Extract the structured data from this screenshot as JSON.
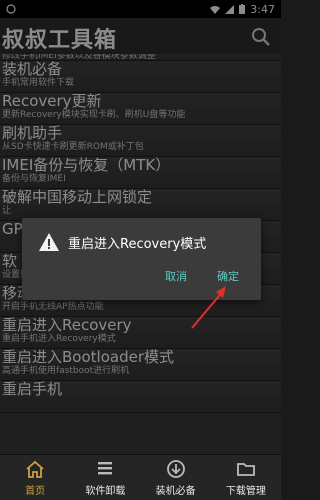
{
  "status": {
    "time": "3:47"
  },
  "appbar": {
    "title": "叔叔工具箱",
    "search_icon": "search-icon"
  },
  "list": {
    "partial_top": "修改手机IMEI参数以及各模块参数调整",
    "items": [
      {
        "title": "装机必备",
        "subtitle": "手机常用软件下载"
      },
      {
        "title": "Recovery更新",
        "subtitle": "更新Recovery模块实现卡刷、刷机U盘等功能"
      },
      {
        "title": "刷机助手",
        "subtitle": "从SD卡快速卡刷更新ROM或补丁包"
      },
      {
        "title": "IMEI备份与恢复（MTK）",
        "subtitle": "备份与恢复IMEI"
      },
      {
        "title": "破解中国移动上网锁定",
        "subtitle": "让"
      },
      {
        "title": "GP",
        "subtitle": ""
      },
      {
        "title": "软",
        "subtitle": "设置软件程序默认安装位置"
      },
      {
        "title": "移动热点AP",
        "subtitle": "开启手机无线AP热点功能"
      },
      {
        "title": "重启进入Recovery",
        "subtitle": "重启手机进入Recovery模式"
      },
      {
        "title": "重启进入Bootloader模式",
        "subtitle": "高通手机使用fastboot进行刷机"
      },
      {
        "title": "重启手机",
        "subtitle": ""
      }
    ]
  },
  "dialog": {
    "title": "重启进入Recovery模式",
    "cancel": "取消",
    "confirm": "确定",
    "icon": "warning-icon"
  },
  "nav": [
    {
      "label": "首页",
      "icon": "home-icon",
      "active": true
    },
    {
      "label": "软件卸载",
      "icon": "list-icon",
      "active": false
    },
    {
      "label": "装机必备",
      "icon": "download-icon",
      "active": false
    },
    {
      "label": "下载管理",
      "icon": "folder-icon",
      "active": false
    }
  ],
  "colors": {
    "accent": "#5ec9c1",
    "nav_active": "#c8a240",
    "annotation_arrow": "#e0302a"
  }
}
